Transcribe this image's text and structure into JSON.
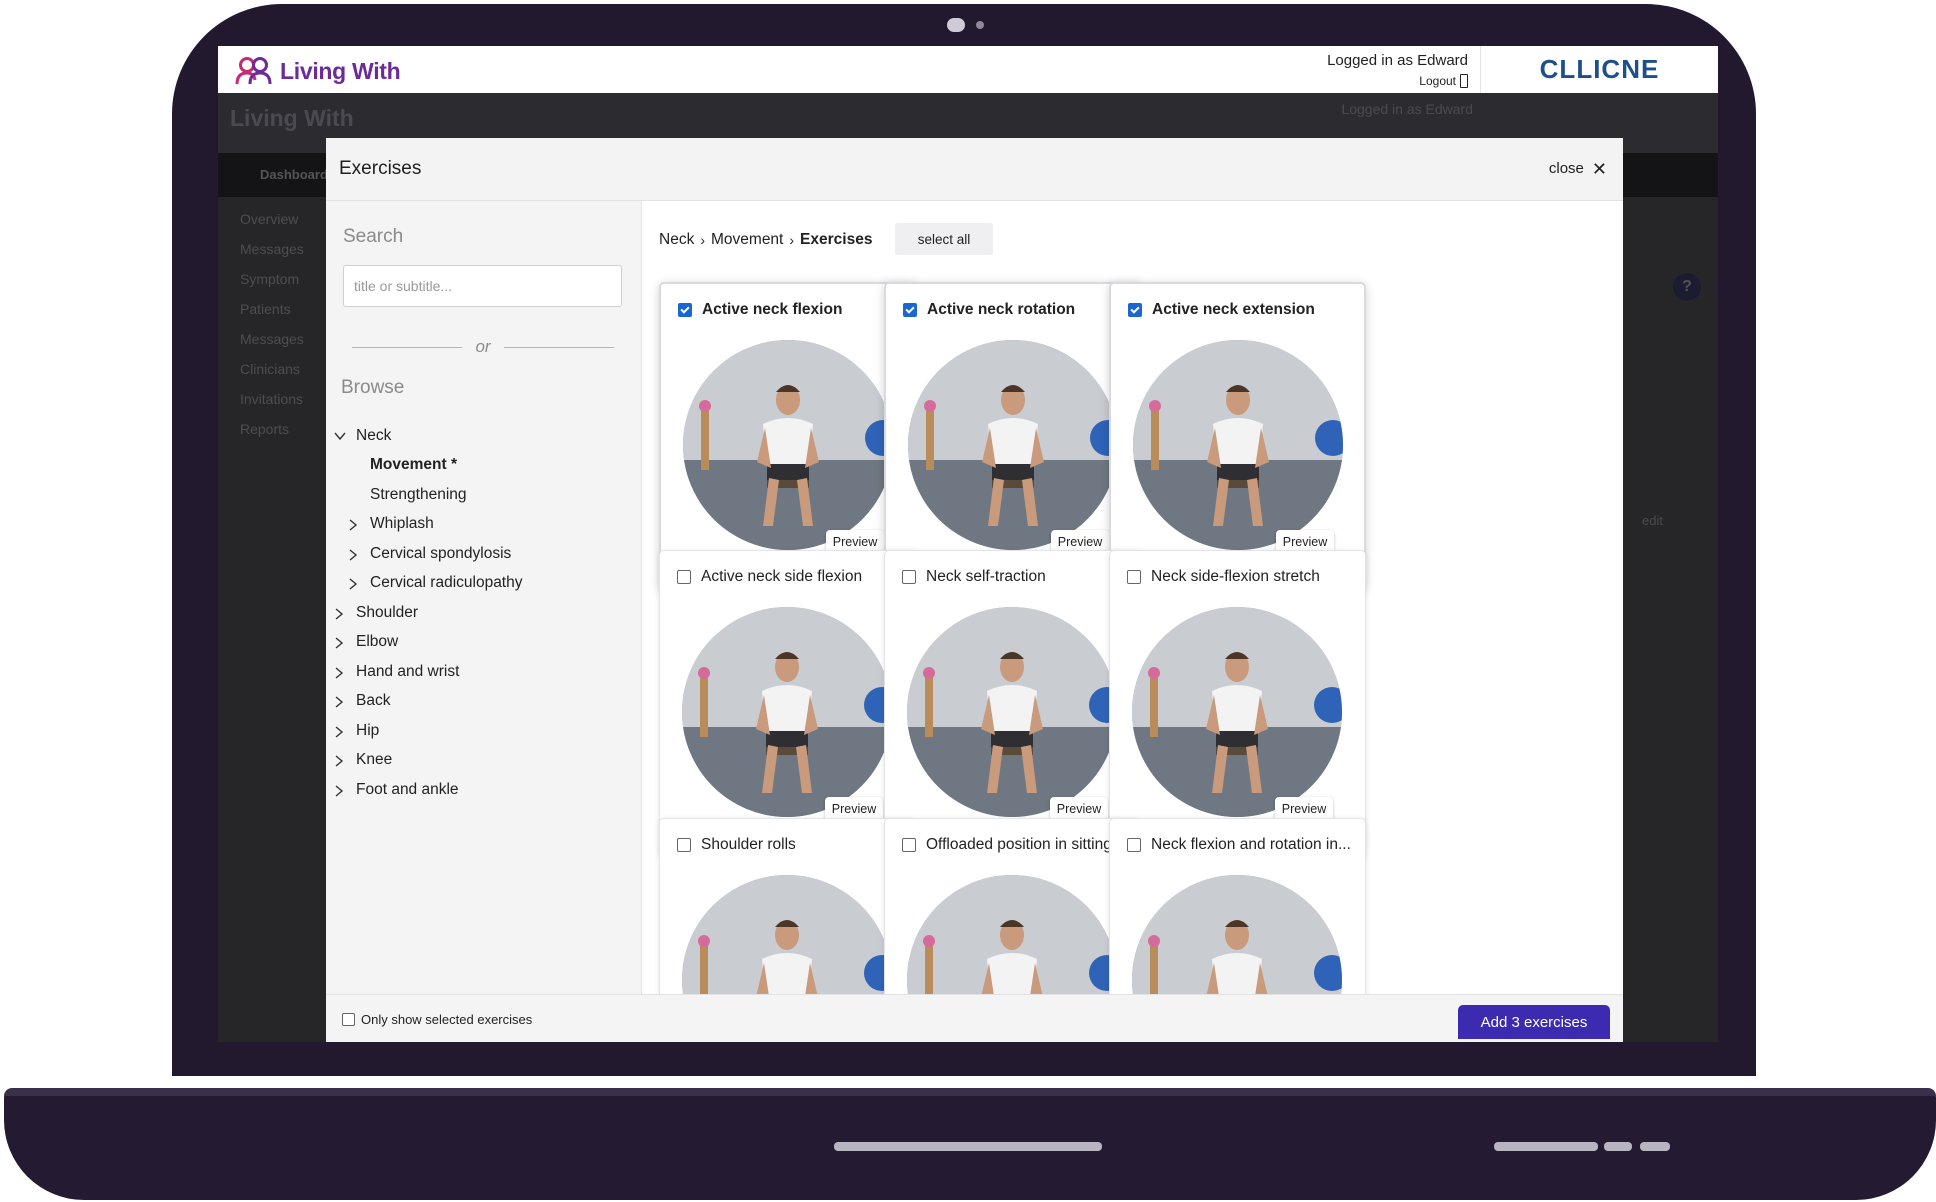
{
  "app": {
    "brand": "Living With",
    "logged_in_text": "Logged in as Edward",
    "logout_label": "Logout",
    "partner_logo_text": "CLLICNE"
  },
  "background": {
    "nav_label": "Dashboard",
    "sidebar_items": [
      "Overview",
      "Messages",
      "Symptom",
      "Patients",
      "Messages",
      "Clinicians",
      "Invitations",
      "Reports"
    ],
    "help_label": "?",
    "edit_label": "edit"
  },
  "modal": {
    "title": "Exercises",
    "close_label": "close",
    "search_label": "Search",
    "search_placeholder": "title or subtitle...",
    "or_label": "or",
    "browse_label": "Browse",
    "tree": [
      {
        "label": "Neck",
        "expanded": true,
        "level": 0
      },
      {
        "label": "Movement *",
        "level": 1,
        "bold": true,
        "leaf": true
      },
      {
        "label": "Strengthening",
        "level": 1,
        "leaf": true
      },
      {
        "label": "Whiplash",
        "level": 1
      },
      {
        "label": "Cervical spondylosis",
        "level": 1
      },
      {
        "label": "Cervical radiculopathy",
        "level": 1
      },
      {
        "label": "Shoulder",
        "level": 0
      },
      {
        "label": "Elbow",
        "level": 0
      },
      {
        "label": "Hand and wrist",
        "level": 0
      },
      {
        "label": "Back",
        "level": 0
      },
      {
        "label": "Hip",
        "level": 0
      },
      {
        "label": "Knee",
        "level": 0
      },
      {
        "label": "Foot and ankle",
        "level": 0
      }
    ],
    "breadcrumb": [
      "Neck",
      "Movement",
      "Exercises"
    ],
    "select_all_label": "select all",
    "preview_label": "Preview",
    "exercises": [
      {
        "title": "Active neck flexion",
        "selected": true
      },
      {
        "title": "Active neck rotation",
        "selected": true
      },
      {
        "title": "Active neck extension",
        "selected": true
      },
      {
        "title": "Active neck side flexion",
        "selected": false
      },
      {
        "title": "Neck self-traction",
        "selected": false
      },
      {
        "title": "Neck side-flexion stretch",
        "selected": false
      },
      {
        "title": "Shoulder rolls",
        "selected": false
      },
      {
        "title": "Offloaded position in sitting",
        "selected": false
      },
      {
        "title": "Neck flexion and rotation in...",
        "selected": false
      }
    ],
    "only_selected_label": "Only show selected exercises",
    "add_button_label": "Add 3 exercises"
  },
  "colors": {
    "brand_purple": "#6b2c9a",
    "brand_pink": "#c72a6e",
    "primary_button": "#3c2bb0",
    "checkbox_checked": "#1a67d2",
    "laptop_frame": "#23192f"
  }
}
